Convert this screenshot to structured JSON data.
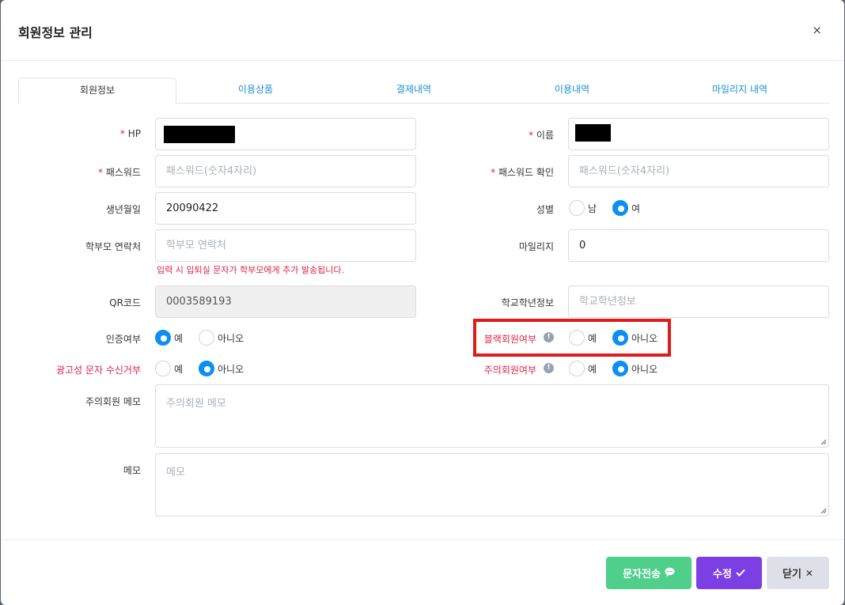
{
  "modal": {
    "title": "회원정보 관리",
    "close": "×"
  },
  "tabs": [
    "회원정보",
    "이용상품",
    "결제내역",
    "이용내역",
    "마일리지 내역"
  ],
  "fields": {
    "hp": {
      "req": "*",
      "label": "HP"
    },
    "name": {
      "req": "*",
      "label": "이름"
    },
    "password": {
      "req": "*",
      "label": "패스워드",
      "placeholder": "패스워드(숫자4자리)"
    },
    "password_confirm": {
      "req": "*",
      "label": "패스워드 확인",
      "placeholder": "패스워드(숫자4자리)"
    },
    "birth": {
      "label": "생년월일",
      "value": "20090422"
    },
    "gender": {
      "label": "성별",
      "options": [
        "남",
        "여"
      ],
      "selected": "여"
    },
    "parent_contact": {
      "label": "학부모 연락처",
      "placeholder": "학부모 연락처",
      "hint": "입력 시 입퇴실 문자가 학부모에게 추가 발송됩니다."
    },
    "mileage": {
      "label": "마일리지",
      "value": "0"
    },
    "qr": {
      "label": "QR코드",
      "value": "0003589193"
    },
    "school": {
      "label": "학교학년정보",
      "placeholder": "학교학년정보"
    },
    "verified": {
      "label": "인증여부",
      "options": [
        "예",
        "아니오"
      ],
      "selected": "예"
    },
    "blacklist": {
      "label": "블랙회원여부",
      "options": [
        "예",
        "아니오"
      ],
      "selected": "아니오"
    },
    "ad_reject": {
      "label": "광고성 문자 수신거부",
      "options": [
        "예",
        "아니오"
      ],
      "selected": "아니오"
    },
    "caution": {
      "label": "주의회원여부",
      "options": [
        "예",
        "아니오"
      ],
      "selected": "아니오"
    },
    "caution_memo": {
      "label": "주의회원 메모",
      "placeholder": "주의회원 메모"
    },
    "memo": {
      "label": "메모",
      "placeholder": "메모"
    }
  },
  "footer": {
    "sms_label": "문자전송",
    "edit_label": "수정",
    "close_label": "닫기"
  },
  "colors": {
    "primary": "#0d8ff1",
    "required": "#e0244a",
    "sms_button": "#4fcf8a",
    "edit_button": "#7b3fe4",
    "close_button": "#dde0e7",
    "highlight_box": "#e01b1b"
  }
}
